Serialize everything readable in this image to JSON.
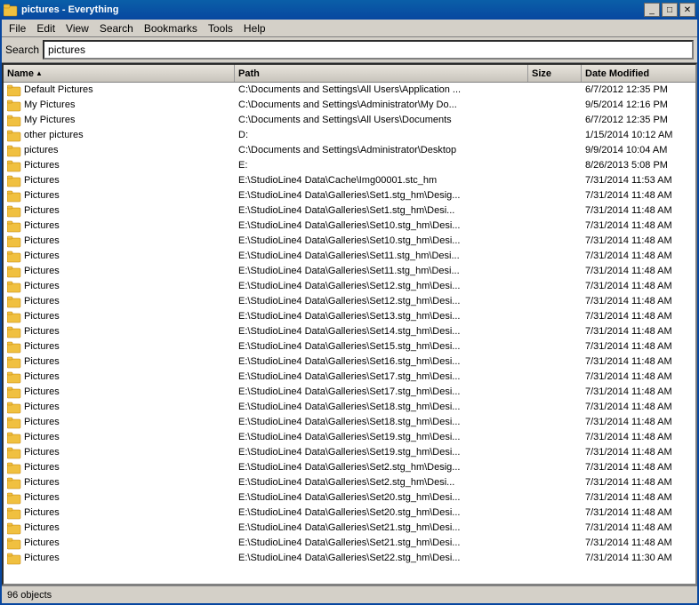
{
  "titleBar": {
    "title": "pictures - Everything",
    "icon": "folder",
    "buttons": [
      "minimize",
      "maximize",
      "close"
    ]
  },
  "menuBar": {
    "items": [
      "File",
      "Edit",
      "View",
      "Search",
      "Bookmarks",
      "Tools",
      "Help"
    ]
  },
  "searchBar": {
    "label": "Search",
    "value": "pictures"
  },
  "tableHeader": {
    "columns": [
      {
        "label": "Name",
        "sort": "asc"
      },
      {
        "label": "Path"
      },
      {
        "label": "Size"
      },
      {
        "label": "Date Modified"
      }
    ]
  },
  "rows": [
    {
      "name": "Default Pictures",
      "path": "C:\\Documents and Settings\\All Users\\Application ...",
      "size": "",
      "date": "6/7/2012 12:35 PM"
    },
    {
      "name": "My Pictures",
      "path": "C:\\Documents and Settings\\Administrator\\My Do...",
      "size": "",
      "date": "9/5/2014 12:16 PM"
    },
    {
      "name": "My Pictures",
      "path": "C:\\Documents and Settings\\All Users\\Documents",
      "size": "",
      "date": "6/7/2012 12:35 PM"
    },
    {
      "name": "other pictures",
      "path": "D:",
      "size": "",
      "date": "1/15/2014 10:12 AM"
    },
    {
      "name": "pictures",
      "path": "C:\\Documents and Settings\\Administrator\\Desktop",
      "size": "",
      "date": "9/9/2014 10:04 AM"
    },
    {
      "name": "Pictures",
      "path": "E:",
      "size": "",
      "date": "8/26/2013 5:08 PM"
    },
    {
      "name": "Pictures",
      "path": "E:\\StudioLine4 Data\\Cache\\Img00001.stc_hm",
      "size": "",
      "date": "7/31/2014 11:53 AM"
    },
    {
      "name": "Pictures",
      "path": "E:\\StudioLine4 Data\\Galleries\\Set1.stg_hm\\Desig...",
      "size": "",
      "date": "7/31/2014 11:48 AM"
    },
    {
      "name": "Pictures",
      "path": "E:\\StudioLine4 Data\\Galleries\\Set1.stg_hm\\Desi...",
      "size": "",
      "date": "7/31/2014 11:48 AM"
    },
    {
      "name": "Pictures",
      "path": "E:\\StudioLine4 Data\\Galleries\\Set10.stg_hm\\Desi...",
      "size": "",
      "date": "7/31/2014 11:48 AM"
    },
    {
      "name": "Pictures",
      "path": "E:\\StudioLine4 Data\\Galleries\\Set10.stg_hm\\Desi...",
      "size": "",
      "date": "7/31/2014 11:48 AM"
    },
    {
      "name": "Pictures",
      "path": "E:\\StudioLine4 Data\\Galleries\\Set11.stg_hm\\Desi...",
      "size": "",
      "date": "7/31/2014 11:48 AM"
    },
    {
      "name": "Pictures",
      "path": "E:\\StudioLine4 Data\\Galleries\\Set11.stg_hm\\Desi...",
      "size": "",
      "date": "7/31/2014 11:48 AM"
    },
    {
      "name": "Pictures",
      "path": "E:\\StudioLine4 Data\\Galleries\\Set12.stg_hm\\Desi...",
      "size": "",
      "date": "7/31/2014 11:48 AM"
    },
    {
      "name": "Pictures",
      "path": "E:\\StudioLine4 Data\\Galleries\\Set12.stg_hm\\Desi...",
      "size": "",
      "date": "7/31/2014 11:48 AM"
    },
    {
      "name": "Pictures",
      "path": "E:\\StudioLine4 Data\\Galleries\\Set13.stg_hm\\Desi...",
      "size": "",
      "date": "7/31/2014 11:48 AM"
    },
    {
      "name": "Pictures",
      "path": "E:\\StudioLine4 Data\\Galleries\\Set14.stg_hm\\Desi...",
      "size": "",
      "date": "7/31/2014 11:48 AM"
    },
    {
      "name": "Pictures",
      "path": "E:\\StudioLine4 Data\\Galleries\\Set15.stg_hm\\Desi...",
      "size": "",
      "date": "7/31/2014 11:48 AM"
    },
    {
      "name": "Pictures",
      "path": "E:\\StudioLine4 Data\\Galleries\\Set16.stg_hm\\Desi...",
      "size": "",
      "date": "7/31/2014 11:48 AM"
    },
    {
      "name": "Pictures",
      "path": "E:\\StudioLine4 Data\\Galleries\\Set17.stg_hm\\Desi...",
      "size": "",
      "date": "7/31/2014 11:48 AM"
    },
    {
      "name": "Pictures",
      "path": "E:\\StudioLine4 Data\\Galleries\\Set17.stg_hm\\Desi...",
      "size": "",
      "date": "7/31/2014 11:48 AM"
    },
    {
      "name": "Pictures",
      "path": "E:\\StudioLine4 Data\\Galleries\\Set18.stg_hm\\Desi...",
      "size": "",
      "date": "7/31/2014 11:48 AM"
    },
    {
      "name": "Pictures",
      "path": "E:\\StudioLine4 Data\\Galleries\\Set18.stg_hm\\Desi...",
      "size": "",
      "date": "7/31/2014 11:48 AM"
    },
    {
      "name": "Pictures",
      "path": "E:\\StudioLine4 Data\\Galleries\\Set19.stg_hm\\Desi...",
      "size": "",
      "date": "7/31/2014 11:48 AM"
    },
    {
      "name": "Pictures",
      "path": "E:\\StudioLine4 Data\\Galleries\\Set19.stg_hm\\Desi...",
      "size": "",
      "date": "7/31/2014 11:48 AM"
    },
    {
      "name": "Pictures",
      "path": "E:\\StudioLine4 Data\\Galleries\\Set2.stg_hm\\Desig...",
      "size": "",
      "date": "7/31/2014 11:48 AM"
    },
    {
      "name": "Pictures",
      "path": "E:\\StudioLine4 Data\\Galleries\\Set2.stg_hm\\Desi...",
      "size": "",
      "date": "7/31/2014 11:48 AM"
    },
    {
      "name": "Pictures",
      "path": "E:\\StudioLine4 Data\\Galleries\\Set20.stg_hm\\Desi...",
      "size": "",
      "date": "7/31/2014 11:48 AM"
    },
    {
      "name": "Pictures",
      "path": "E:\\StudioLine4 Data\\Galleries\\Set20.stg_hm\\Desi...",
      "size": "",
      "date": "7/31/2014 11:48 AM"
    },
    {
      "name": "Pictures",
      "path": "E:\\StudioLine4 Data\\Galleries\\Set21.stg_hm\\Desi...",
      "size": "",
      "date": "7/31/2014 11:48 AM"
    },
    {
      "name": "Pictures",
      "path": "E:\\StudioLine4 Data\\Galleries\\Set21.stg_hm\\Desi...",
      "size": "",
      "date": "7/31/2014 11:48 AM"
    },
    {
      "name": "Pictures",
      "path": "E:\\StudioLine4 Data\\Galleries\\Set22.stg_hm\\Desi...",
      "size": "",
      "date": "7/31/2014 11:30 AM"
    }
  ],
  "statusBar": {
    "count": "96 objects"
  }
}
